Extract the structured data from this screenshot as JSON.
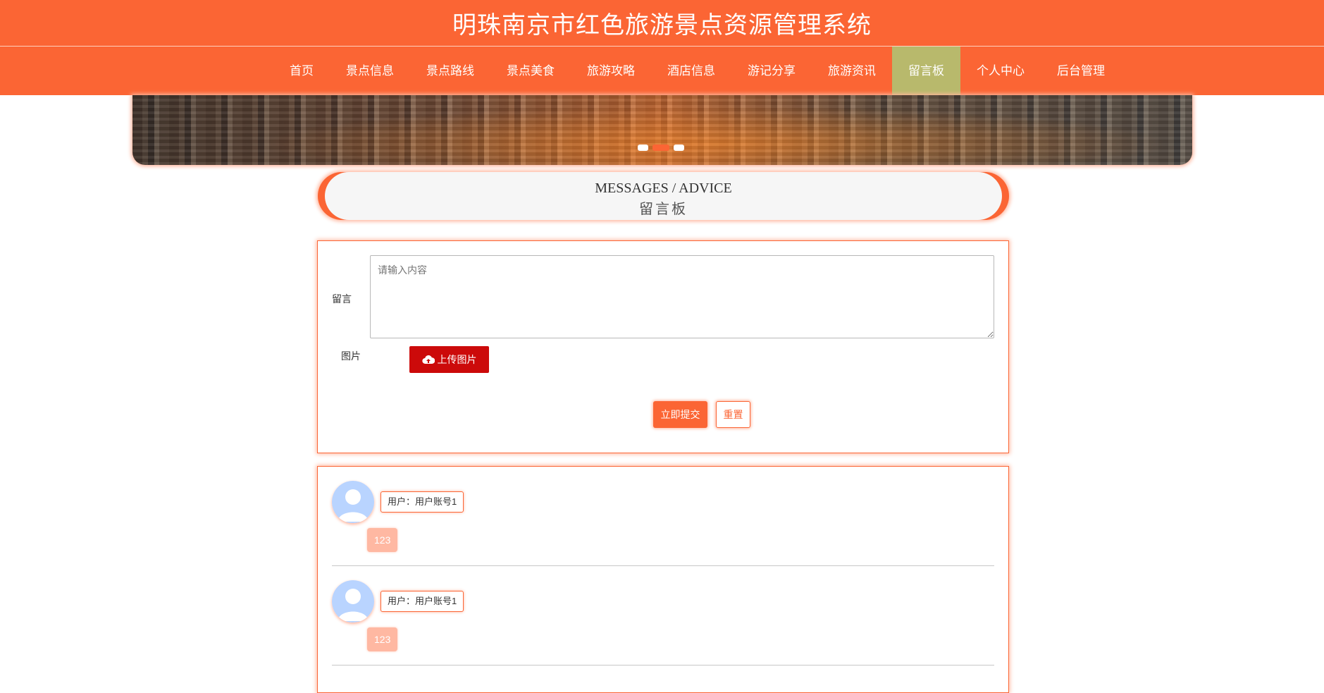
{
  "header": {
    "title": "明珠南京市红色旅游景点资源管理系统"
  },
  "nav": {
    "items": [
      {
        "label": "首页"
      },
      {
        "label": "景点信息"
      },
      {
        "label": "景点路线"
      },
      {
        "label": "景点美食"
      },
      {
        "label": "旅游攻略"
      },
      {
        "label": "酒店信息"
      },
      {
        "label": "游记分享"
      },
      {
        "label": "旅游资讯"
      },
      {
        "label": "留言板"
      },
      {
        "label": "个人中心"
      },
      {
        "label": "后台管理"
      }
    ],
    "active": "留言板"
  },
  "section": {
    "title_en": "MESSAGES / ADVICE",
    "title_cn": "留言板"
  },
  "form": {
    "message_label": "留言",
    "message_placeholder": "请输入内容",
    "image_label": "图片",
    "upload_label": "上传图片",
    "submit_label": "立即提交",
    "reset_label": "重置"
  },
  "messages": [
    {
      "user": "用户：用户账号1",
      "content": "123"
    },
    {
      "user": "用户：用户账号1",
      "content": "123"
    }
  ],
  "colors": {
    "primary": "#fb6534",
    "active_nav": "#b8b96c",
    "upload": "#cc0a0a"
  }
}
